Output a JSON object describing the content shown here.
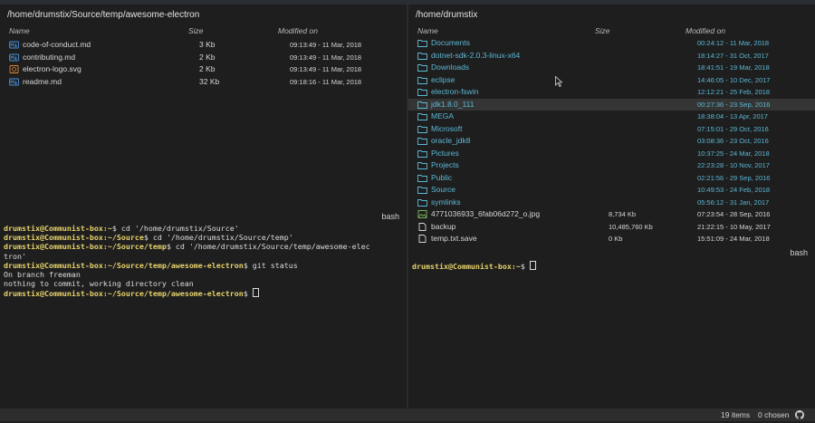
{
  "left": {
    "path": "/home/drumstix/Source/temp/awesome-electron",
    "columns": {
      "name": "Name",
      "size": "Size",
      "modified": "Modified on"
    },
    "files": [
      {
        "name": "code-of-conduct.md",
        "size": "3 Kb",
        "modified": "09:13:49 - 11 Mar, 2018",
        "icon": "markdown-icon",
        "color": "#4a90d9"
      },
      {
        "name": "contributing.md",
        "size": "2 Kb",
        "modified": "09:13:49 - 11 Mar, 2018",
        "icon": "markdown-icon",
        "color": "#4a90d9"
      },
      {
        "name": "electron-logo.svg",
        "size": "2 Kb",
        "modified": "09:13:49 - 11 Mar, 2018",
        "icon": "svg-image-icon",
        "color": "#e0893a"
      },
      {
        "name": "readme.md",
        "size": "32 Kb",
        "modified": "09:18:16 - 11 Mar, 2018",
        "icon": "markdown-icon",
        "color": "#4a90d9"
      }
    ],
    "terminal": {
      "label": "bash",
      "lines": [
        {
          "user": "drumstix@Communist-box",
          "path": ":~",
          "cmd": "$ cd '/home/drumstix/Source'"
        },
        {
          "user": "drumstix@Communist-box",
          "path": ":~/Source",
          "cmd": "$ cd '/home/drumstix/Source/temp'"
        },
        {
          "user": "drumstix@Communist-box",
          "path": ":~/Source/temp",
          "cmd": "$ cd '/home/drumstix/Source/temp/awesome-elec"
        },
        {
          "user": "",
          "path": "",
          "cmd": "tron'"
        },
        {
          "user": "drumstix@Communist-box",
          "path": ":~/Source/temp/awesome-electron",
          "cmd": "$ git status"
        },
        {
          "user": "",
          "path": "",
          "cmd": "On branch freeman"
        },
        {
          "user": "",
          "path": "",
          "cmd": "nothing to commit, working directory clean"
        },
        {
          "user": "drumstix@Communist-box",
          "path": ":~/Source/temp/awesome-electron",
          "cmd": "$ "
        }
      ]
    }
  },
  "right": {
    "path": "/home/drumstix",
    "columns": {
      "name": "Name",
      "size": "Size",
      "modified": "Modified on"
    },
    "items": [
      {
        "name": "Documents",
        "size": "",
        "modified": "00:24:12 - 11 Mar, 2018",
        "type": "folder"
      },
      {
        "name": "dotnet-sdk-2.0.3-linux-x64",
        "size": "",
        "modified": "18:14:27 - 31 Oct, 2017",
        "type": "folder"
      },
      {
        "name": "Downloads",
        "size": "",
        "modified": "18:41:51 - 19 Mar, 2018",
        "type": "folder"
      },
      {
        "name": "eclipse",
        "size": "",
        "modified": "14:46:05 - 10 Dec, 2017",
        "type": "folder"
      },
      {
        "name": "electron-fswin",
        "size": "",
        "modified": "12:12:21 - 25 Feb, 2018",
        "type": "folder"
      },
      {
        "name": "jdk1.8.0_111",
        "size": "",
        "modified": "00:27:36 - 23 Sep, 2016",
        "type": "folder",
        "selected": true
      },
      {
        "name": "MEGA",
        "size": "",
        "modified": "18:38:04 - 13 Apr, 2017",
        "type": "folder"
      },
      {
        "name": "Microsoft",
        "size": "",
        "modified": "07:15:01 - 29 Oct, 2016",
        "type": "folder"
      },
      {
        "name": "oracle_jdk8",
        "size": "",
        "modified": "03:08:36 - 23 Oct, 2016",
        "type": "folder"
      },
      {
        "name": "Pictures",
        "size": "",
        "modified": "10:37:25 - 24 Mar, 2018",
        "type": "folder"
      },
      {
        "name": "Projects",
        "size": "",
        "modified": "22:23:28 - 10 Nov, 2017",
        "type": "folder"
      },
      {
        "name": "Public",
        "size": "",
        "modified": "02:21:56 - 29 Sep, 2016",
        "type": "folder"
      },
      {
        "name": "Source",
        "size": "",
        "modified": "10:49:53 - 24 Feb, 2018",
        "type": "folder"
      },
      {
        "name": "symlinks",
        "size": "",
        "modified": "05:56:12 - 31 Jan, 2017",
        "type": "folder"
      },
      {
        "name": "4771036933_6fab06d272_o.jpg",
        "size": "8,734 Kb",
        "modified": "07:23:54 - 28 Sep, 2016",
        "type": "image"
      },
      {
        "name": "backup",
        "size": "10,485,760 Kb",
        "modified": "21:22:15 - 10 May, 2017",
        "type": "file"
      },
      {
        "name": "temp.txt.save",
        "size": "0 Kb",
        "modified": "15:51:09 - 24 Mar, 2018",
        "type": "file"
      }
    ],
    "terminal": {
      "label": "bash",
      "lines": [
        {
          "user": "drumstix@Communist-box",
          "path": ":~",
          "cmd": "$ "
        }
      ]
    }
  },
  "status": {
    "items": "19 items",
    "chosen": "0 chosen",
    "icon": "github-icon"
  },
  "colors": {
    "folder": "#5cb8d6",
    "prompt": "#e8d36b",
    "background": "#1e1e1e"
  }
}
